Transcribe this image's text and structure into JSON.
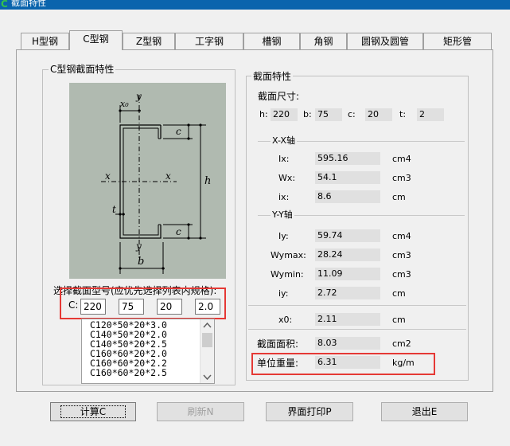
{
  "window": {
    "title": "截面特性"
  },
  "tabs": [
    "H型钢",
    "C型钢",
    "Z型钢",
    "工字钢",
    "槽钢",
    "角钢",
    "圆钢及圆管",
    "矩形管"
  ],
  "active_tab": "C型钢",
  "left_group": {
    "title": "C型钢截面特性",
    "diagram_labels": {
      "y_top": "y",
      "x0": "x₀",
      "c_top": "c",
      "x_left": "x",
      "x_right": "x",
      "h": "h",
      "t": "t",
      "c_bottom": "c",
      "y_bottom": "y",
      "b": "b"
    },
    "select_label": "选择截面型号(应优先选择列表内规格):",
    "c_label": "C:",
    "inputs": {
      "h": "220",
      "b": "75",
      "c": "20",
      "t": "2.0"
    },
    "list_items": [
      "C120*50*20*3.0",
      "C140*50*20*2.0",
      "C140*50*20*2.5",
      "C160*60*20*2.0",
      "C160*60*20*2.2",
      "C160*60*20*2.5"
    ]
  },
  "right_group": {
    "title": "截面特性",
    "dims_label": "截面尺寸:",
    "dims": {
      "h_label": "h:",
      "h": "220",
      "b_label": "b:",
      "b": "75",
      "c_label": "c:",
      "c": "20",
      "t_label": "t:",
      "t": "2"
    },
    "xx_title": "X-X轴",
    "xx": [
      {
        "label": "Ix:",
        "value": "595.16",
        "unit": "cm4"
      },
      {
        "label": "Wx:",
        "value": "54.1",
        "unit": "cm3"
      },
      {
        "label": "ix:",
        "value": "8.6",
        "unit": "cm"
      }
    ],
    "yy_title": "Y-Y轴",
    "yy": [
      {
        "label": "Iy:",
        "value": "59.74",
        "unit": "cm4"
      },
      {
        "label": "Wymax:",
        "value": "28.24",
        "unit": "cm3"
      },
      {
        "label": "Wymin:",
        "value": "11.09",
        "unit": "cm3"
      },
      {
        "label": "iy:",
        "value": "2.72",
        "unit": "cm"
      }
    ],
    "x0": {
      "label": "x0:",
      "value": "2.11",
      "unit": "cm"
    },
    "area": {
      "label": "截面面积:",
      "value": "8.03",
      "unit": "cm2"
    },
    "weight": {
      "label": "单位重量:",
      "value": "6.31",
      "unit": "kg/m"
    }
  },
  "buttons": {
    "calc": "计算C",
    "refresh": "刷新N",
    "print": "界面打印P",
    "exit": "退出E"
  },
  "colors": {
    "titlebar": "#0a64ad",
    "diagram_bg": "#b0bab0",
    "highlight": "#e53935"
  }
}
